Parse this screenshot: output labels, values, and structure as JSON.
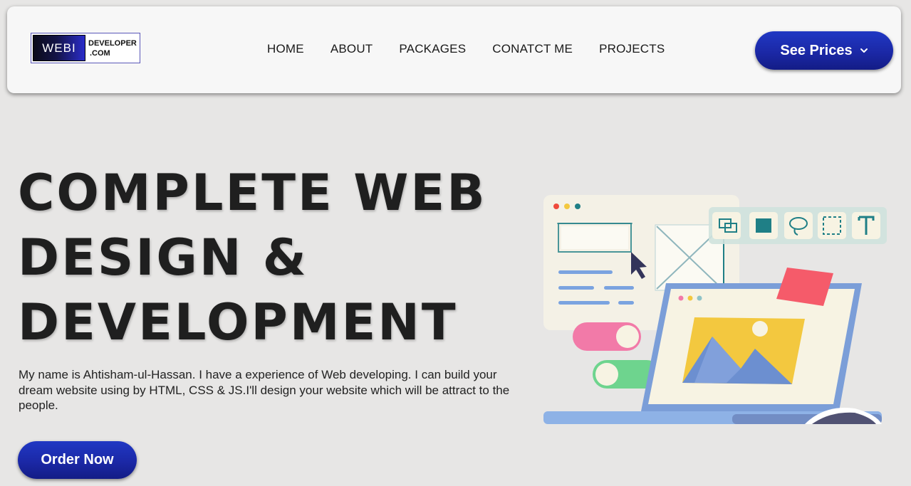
{
  "logo": {
    "left_text": "WEBI",
    "right_top": "DEVELOPER",
    "right_bottom": ".COM"
  },
  "nav": {
    "items": [
      "HOME",
      "ABOUT",
      "PACKAGES",
      "CONATCT ME",
      "PROJECTS"
    ]
  },
  "header": {
    "cta_label": "See Prices"
  },
  "hero": {
    "title_line1": "COMPLETE WEB",
    "title_line2": "DESIGN &",
    "title_line3": "DEVELOPMENT",
    "description": "My name is Ahtisham-ul-Hassan. I have a experience of Web developing. I can build your dream website using by HTML, CSS & JS.I'll design your website which will be attract to the people.",
    "cta_label": "Order Now"
  },
  "colors": {
    "background": "#e7e6e5",
    "header_bg": "#f7f7f7",
    "button_blue": "#1b28a6",
    "heading": "#1f1f1f"
  },
  "icons": [
    "chevron-down-icon",
    "cursor-icon",
    "image-icon",
    "text-tool-icon",
    "select-tool-icon",
    "lasso-tool-icon"
  ]
}
